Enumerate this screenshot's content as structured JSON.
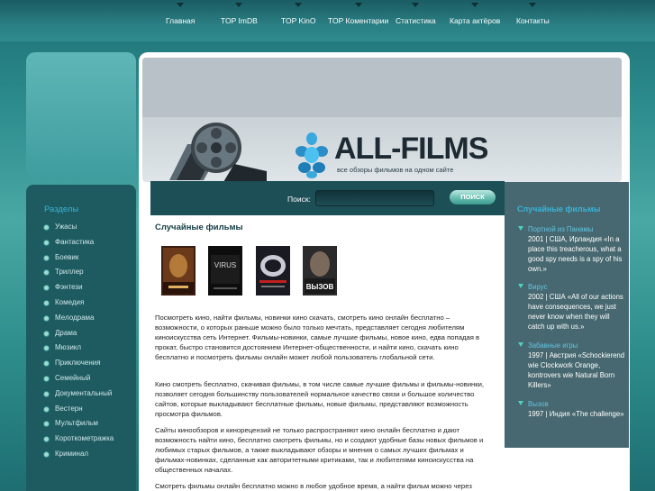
{
  "nav": {
    "items": [
      "Главная",
      "TOP ImDB",
      "TOP KinO",
      "TOP Коментарии",
      "Статистика",
      "Карта актёров",
      "Контакты"
    ]
  },
  "sidebar": {
    "title": "Разделы",
    "items": [
      "Ужасы",
      "Фантастика",
      "Боевик",
      "Триллер",
      "Фэнтези",
      "Комедия",
      "Мелодрама",
      "Драма",
      "Мюзикл",
      "Приключения",
      "Семейный",
      "Документальный",
      "Вестерн",
      "Мультфильм",
      "Короткометражка",
      "Криминал"
    ]
  },
  "header": {
    "logo_text": "ALL-FILMS",
    "logo_subtitle": "все обзоры фильмов на одном сайте"
  },
  "search": {
    "label": "Поиск:",
    "button_label": "ПОИСК",
    "placeholder": "",
    "value": ""
  },
  "main": {
    "title": "Случайные фильмы",
    "posters": [
      {
        "name": "poster-1",
        "poster_text": ""
      },
      {
        "name": "poster-2",
        "poster_text": "VIRUS"
      },
      {
        "name": "poster-3",
        "poster_text": ""
      },
      {
        "name": "poster-4",
        "poster_text": "ВЫЗОВ"
      }
    ],
    "paragraphs": [
      "Посмотреть кино, найти фильмы, новинки кино скачать, смотреть кино онлайн бесплатно –возможности, о которых раньше можно было только мечтать, представляет сегодня любителям киноискусства сеть Интернет. Фильмы-новинки, самые лучшие фильмы, новое кино, едва попадая в прокат, быстро становится достоянием Интернет-общественности, и найти кино, скачать кино бесплатно и посмотреть фильмы онлайн может любой пользователь глобальной сети.",
      "Кино смотреть бесплатно, скачивая фильмы, в том числе самые лучшие фильмы и фильмы-новинки, позволяет сегодня большинству пользователей нормальное качество связи и большое количество сайтов, которые выкладывают бесплатные фильмы, новые фильмы, представляют возможность просмотра фильмов.",
      "Сайты кинообзоров и кинорецензий не только распространяют кино онлайн бесплатно и дают возможность найти кино, бесплатно смотреть фильмы, но и создают удобные базы новых фильмов и любимых старых фильмов, а также выкладывают обзоры и мнения о самых лучших фильмах и фильмах-новинках, сделанные как авторитетными критиками, так и любителями киноискусства на общественных началах.",
      "Смотреть фильмы онлайн бесплатно можно в любое удобное время, а найти фильм можно через"
    ]
  },
  "random_films": {
    "title": "Случайные фильмы",
    "items": [
      {
        "title": "Портной из Панамы",
        "desc": "2001 | США, Ирландия «In a place this treacherous, what a good spy needs is a spy of his own.»"
      },
      {
        "title": "Вирус",
        "desc": "2002 | США «All of our actions have consequences, we just never know when they will catch up with us.»"
      },
      {
        "title": "Забавные игры",
        "desc": "1997 | Австрия «Schockierend wie Clockwork Orange, kontrovers wie Natural Born Killers»"
      },
      {
        "title": "Вызов",
        "desc": "1997 | Индия «The challenge»"
      }
    ]
  },
  "colors": {
    "accent": "#39b3d6",
    "nav_bg": "#2a7f83",
    "sidebar_bg": "#1d5b60",
    "search_bg": "#1d4f56",
    "right_panel_bg": "#476870"
  }
}
